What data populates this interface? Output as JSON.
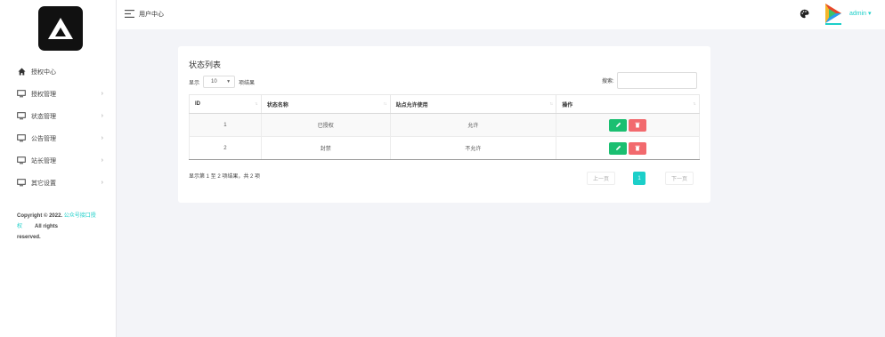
{
  "header": {
    "page_title": "用户中心",
    "user": "admin ▾"
  },
  "sidebar": {
    "items": [
      {
        "label": "授权中心",
        "icon": "home-icon",
        "chevron": ""
      },
      {
        "label": "授权管理",
        "icon": "monitor-icon",
        "chevron": "›"
      },
      {
        "label": "状态管理",
        "icon": "monitor-icon",
        "chevron": "›"
      },
      {
        "label": "公告管理",
        "icon": "monitor-icon",
        "chevron": "›"
      },
      {
        "label": "站长管理",
        "icon": "monitor-icon",
        "chevron": "›"
      },
      {
        "label": "其它设置",
        "icon": "monitor-icon",
        "chevron": "›"
      }
    ],
    "copyright_prefix": "Copyright © 2022. ",
    "copyright_link_1": "公众号接口授",
    "copyright_link_2": "权",
    "copyright_suffix": "All rights",
    "copyright_end": "reserved."
  },
  "card": {
    "title": "状态列表",
    "length_prefix": "显示",
    "length_value": "10",
    "length_suffix": "项结果",
    "search_label": "搜索:",
    "search_placeholder": "",
    "columns": [
      "ID",
      "状态名称",
      "站点允许使用",
      "操作"
    ],
    "rows": [
      {
        "id": "1",
        "name": "已授权",
        "allowed": "允许"
      },
      {
        "id": "2",
        "name": "封禁",
        "allowed": "不允许"
      }
    ],
    "info": "显示第 1 至 2 项结果，共 2 项",
    "pager": {
      "prev": "上一页",
      "current": "1",
      "next": "下一页"
    }
  },
  "colors": {
    "accent": "#1ccfc9",
    "edit": "#1bbf71",
    "delete": "#f26a6e"
  }
}
